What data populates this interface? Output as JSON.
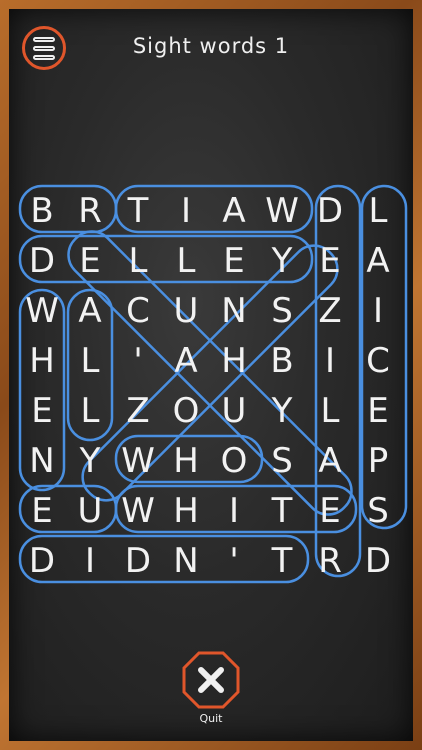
{
  "header": {
    "title": "Sight words 1"
  },
  "grid": {
    "rows": [
      [
        "B",
        "R",
        "T",
        "I",
        "A",
        "W",
        "D",
        "L"
      ],
      [
        "D",
        "E",
        "L",
        "L",
        "E",
        "Y",
        "E",
        "A"
      ],
      [
        "W",
        "A",
        "C",
        "U",
        "N",
        "S",
        "Z",
        "I"
      ],
      [
        "H",
        "L",
        "'",
        "A",
        "H",
        "B",
        "I",
        "C"
      ],
      [
        "E",
        "L",
        "Z",
        "O",
        "U",
        "Y",
        "L",
        "E"
      ],
      [
        "N",
        "Y",
        "W",
        "H",
        "O",
        "S",
        "A",
        "P"
      ],
      [
        "E",
        "U",
        "W",
        "H",
        "I",
        "T",
        "E",
        "S"
      ],
      [
        "D",
        "I",
        "D",
        "N",
        "'",
        "T",
        "R",
        "D"
      ]
    ]
  },
  "footer": {
    "quit_label": "Quit"
  },
  "colors": {
    "highlight": "#4a8fe0",
    "accent": "#e0562b"
  },
  "icons": {
    "menu": "menu-icon",
    "quit": "close-icon"
  }
}
